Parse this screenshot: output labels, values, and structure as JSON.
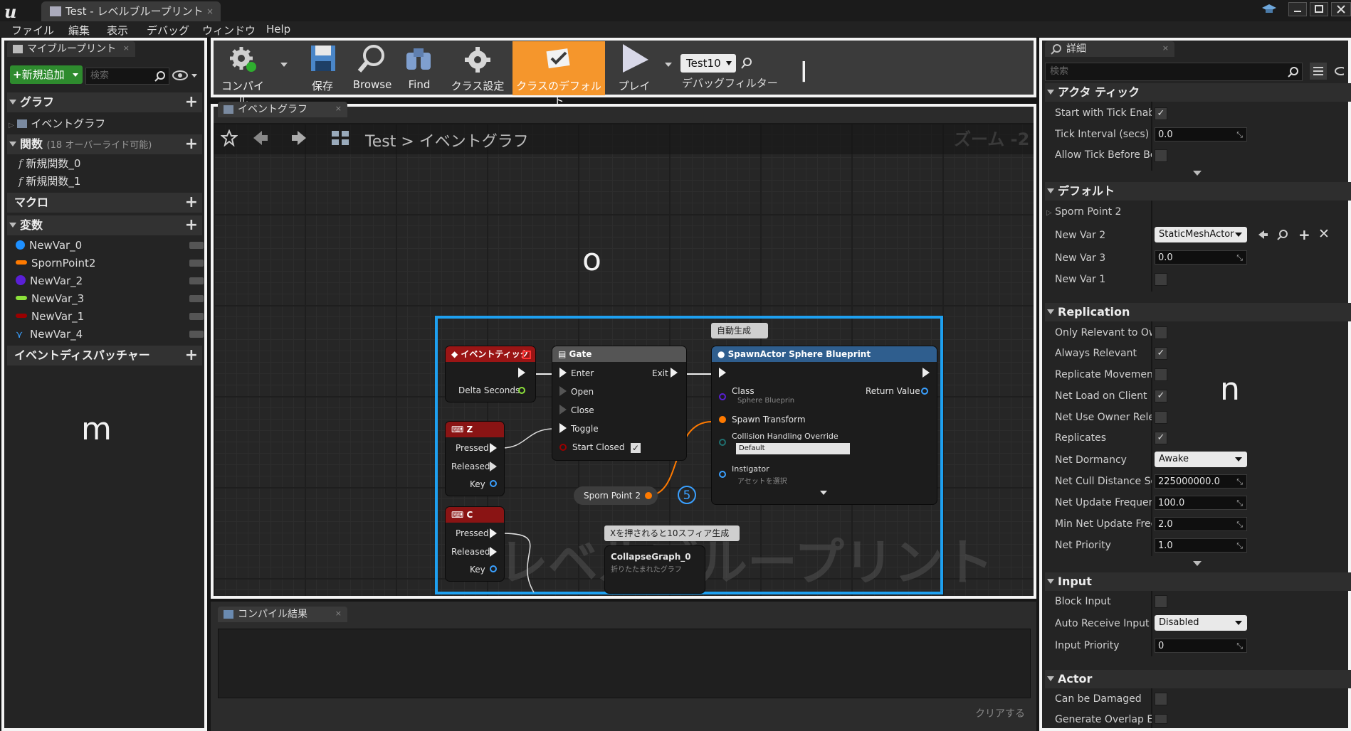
{
  "window": {
    "logo": "u",
    "tab_title": "Test - レベルブループリント",
    "tab_close": "×"
  },
  "menu": [
    "ファイル",
    "編集",
    "表示",
    "デバッグ",
    "ウィンドウ",
    "Help"
  ],
  "left_panel": {
    "tab": "マイブループリント",
    "tab_close": "×",
    "add_new": "新規追加",
    "search_placeholder": "検索",
    "sections": {
      "graph": "グラフ",
      "functions": "関数",
      "functions_note": "(18 オーバーライド可能)",
      "macros": "マクロ",
      "variables": "変数",
      "dispatchers": "イベントディスパッチャー"
    },
    "graph_items": [
      "イベントグラフ"
    ],
    "function_items": [
      "新規関数_0",
      "新規関数_1"
    ],
    "variables": [
      {
        "name": "NewVar_0",
        "color": "#1e90ff"
      },
      {
        "name": "SpornPoint2",
        "color": "#ff7a00"
      },
      {
        "name": "NewVar_2",
        "color": "#5a1fd6"
      },
      {
        "name": "NewVar_3",
        "color": "#8ce03a"
      },
      {
        "name": "NewVar_1",
        "color": "#9a0000"
      },
      {
        "name": "NewVar_4",
        "color": "#3aa0ff"
      }
    ]
  },
  "toolbar": {
    "compile": "コンパイル",
    "save": "保存",
    "browse": "Browse",
    "find": "Find",
    "class_settings": "クラス設定",
    "class_defaults": "クラスのデフォルト",
    "play": "プレイ",
    "debug_object": "Test10",
    "debug_filter": "デバッグフィルター",
    "active_color": "#f5962c"
  },
  "graph": {
    "tab": "イベントグラフ",
    "tab_close": "×",
    "breadcrumb_root": "Test",
    "breadcrumb_sep": ">",
    "breadcrumb_current": "イベントグラフ",
    "zoom": "ズーム -2",
    "watermark": "レベルブループリント",
    "selection_color": "#1ea0f0",
    "comment_auto": "自動生成",
    "comment_x": "Xを押されると10スフィア生成",
    "nodes": {
      "event_tick": {
        "title": "イベントティック",
        "pin_delta": "Delta Seconds"
      },
      "gate": {
        "title": "Gate",
        "enter": "Enter",
        "open": "Open",
        "close": "Close",
        "toggle": "Toggle",
        "start_closed": "Start Closed",
        "exit": "Exit"
      },
      "z": {
        "title": "Z",
        "pressed": "Pressed",
        "released": "Released",
        "key": "Key"
      },
      "c": {
        "title": "C",
        "pressed": "Pressed",
        "released": "Released",
        "key": "Key"
      },
      "spawn": {
        "title": "SpawnActor Sphere Blueprint",
        "class": "Class",
        "class_value": "Sphere Blueprin",
        "return": "Return Value",
        "spawn_transform": "Spawn Transform",
        "collision": "Collision Handling Override",
        "collision_value": "Default",
        "instigator": "Instigator",
        "instigator_value": "アセットを選択"
      },
      "sporn": {
        "title": "Sporn Point 2"
      },
      "collapse": {
        "title": "CollapseGraph_0",
        "subtitle": "折りたたまれたグラフ"
      }
    },
    "badge": "5"
  },
  "compile_results": {
    "tab": "コンパイル結果",
    "tab_close": "×",
    "clear": "クリアする"
  },
  "details": {
    "tab": "詳細",
    "tab_close": "×",
    "search_placeholder": "検索",
    "sections": {
      "actor_tick": "アクタ ティック",
      "default": "デフォルト",
      "replication": "Replication",
      "input": "Input",
      "actor": "Actor"
    },
    "actor_tick": {
      "start_with_tick": "Start with Tick Enab",
      "start_with_tick_checked": true,
      "tick_interval": "Tick Interval (secs)",
      "tick_interval_value": "0.0",
      "allow_tick": "Allow Tick Before Be",
      "allow_tick_checked": false
    },
    "default": {
      "sporn_point": "Sporn Point 2",
      "new_var_2": "New Var 2",
      "new_var_2_value": "StaticMeshActor",
      "new_var_3": "New Var 3",
      "new_var_3_value": "0.0",
      "new_var_1": "New Var 1",
      "new_var_1_checked": false
    },
    "replication": {
      "only_relevant": "Only Relevant to Ow",
      "only_relevant_checked": false,
      "always_relevant": "Always Relevant",
      "always_relevant_checked": true,
      "replicate_movement": "Replicate Movemen",
      "replicate_movement_checked": false,
      "net_load": "Net Load on Client",
      "net_load_checked": true,
      "net_use_owner": "Net Use Owner Relev",
      "net_use_owner_checked": false,
      "replicates": "Replicates",
      "replicates_checked": true,
      "net_dormancy": "Net Dormancy",
      "net_dormancy_value": "Awake",
      "net_cull": "Net Cull Distance Sq",
      "net_cull_value": "225000000.0",
      "net_update": "Net Update Frequenc",
      "net_update_value": "100.0",
      "min_net_update": "Min Net Update Freq",
      "min_net_update_value": "2.0",
      "net_priority": "Net Priority",
      "net_priority_value": "1.0"
    },
    "input": {
      "block_input": "Block Input",
      "block_input_checked": false,
      "auto_receive": "Auto Receive Input",
      "auto_receive_value": "Disabled",
      "input_priority": "Input Priority",
      "input_priority_value": "0"
    },
    "actor": {
      "can_be_damaged": "Can be Damaged",
      "generate_overlap": "Generate Overlap Ev"
    }
  },
  "annotations": {
    "left": "m",
    "toolbar": "l",
    "graph": "o",
    "details": "n"
  }
}
